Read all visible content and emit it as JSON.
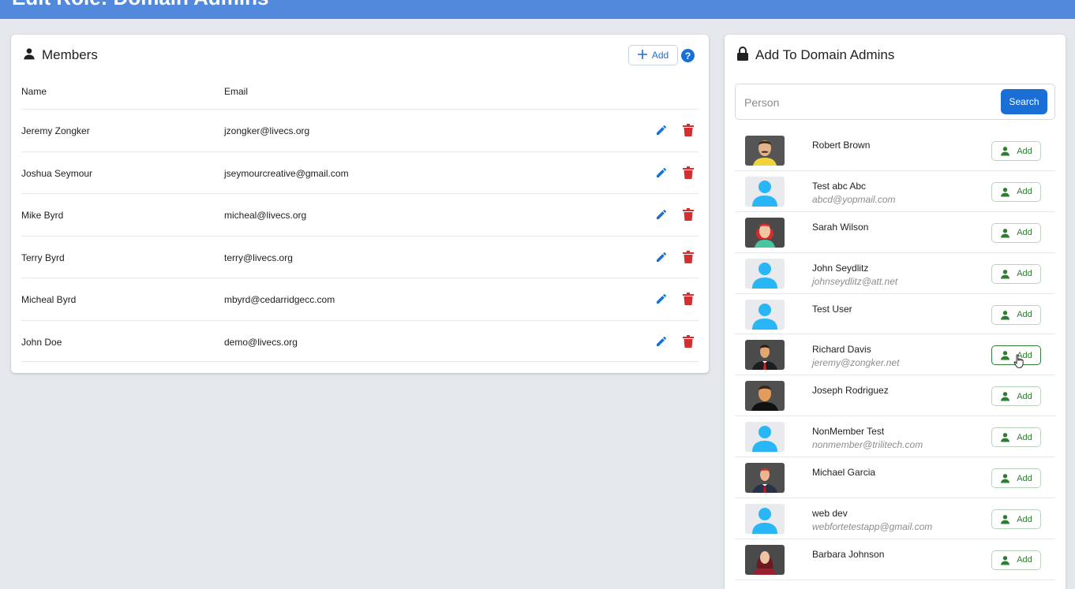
{
  "page": {
    "title": "Edit Role: Domain Admins"
  },
  "members": {
    "title": "Members",
    "add_label": "Add",
    "help_label": "?",
    "columns": {
      "name": "Name",
      "email": "Email"
    },
    "rows": [
      {
        "name": "Jeremy Zongker",
        "email": "jzongker@livecs.org"
      },
      {
        "name": "Joshua Seymour",
        "email": "jseymourcreative@gmail.com"
      },
      {
        "name": "Mike Byrd",
        "email": "micheal@livecs.org"
      },
      {
        "name": "Terry Byrd",
        "email": "terry@livecs.org"
      },
      {
        "name": "Micheal Byrd",
        "email": "mbyrd@cedarridgecc.com"
      },
      {
        "name": "John Doe",
        "email": "demo@livecs.org"
      }
    ]
  },
  "add_panel": {
    "title": "Add To Domain Admins",
    "search": {
      "placeholder": "Person",
      "value": "",
      "button_label": "Search"
    },
    "people": [
      {
        "name": "Robert Brown",
        "email": "",
        "avatar": "man-mustache-yellow",
        "add_label": "Add"
      },
      {
        "name": "Test abc Abc",
        "email": "abcd@yopmail.com",
        "avatar": "default-person",
        "add_label": "Add"
      },
      {
        "name": "Sarah Wilson",
        "email": "",
        "avatar": "woman-red-hair",
        "add_label": "Add"
      },
      {
        "name": "John Seydlitz",
        "email": "johnseydlitz@att.net",
        "avatar": "default-person",
        "add_label": "Add"
      },
      {
        "name": "Test User",
        "email": "",
        "avatar": "default-person",
        "add_label": "Add"
      },
      {
        "name": "Richard Davis",
        "email": "jeremy@zongker.net",
        "avatar": "man-suit-red-tie",
        "add_label": "Add"
      },
      {
        "name": "Joseph Rodriguez",
        "email": "",
        "avatar": "man-black-shirt",
        "add_label": "Add"
      },
      {
        "name": "NonMember Test",
        "email": "nonmember@trilitech.com",
        "avatar": "default-person",
        "add_label": "Add"
      },
      {
        "name": "Michael Garcia",
        "email": "",
        "avatar": "man-suit-blue",
        "add_label": "Add"
      },
      {
        "name": "web dev",
        "email": "webfortetestapp@gmail.com",
        "avatar": "default-person",
        "add_label": "Add"
      },
      {
        "name": "Barbara Johnson",
        "email": "",
        "avatar": "woman-dark-red",
        "add_label": "Add"
      }
    ]
  },
  "colors": {
    "header_bar": "#5289dc",
    "primary": "#1a6fd6",
    "danger": "#d32f2f",
    "success": "#2e7d32",
    "avatar_default": "#29b6f6"
  }
}
